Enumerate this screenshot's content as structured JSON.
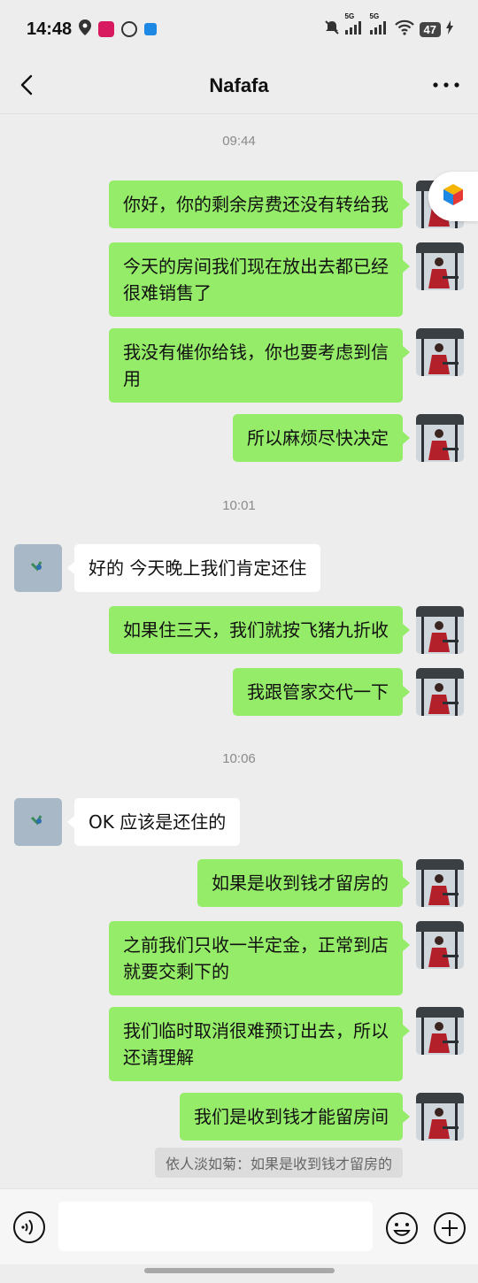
{
  "status_bar": {
    "time": "14:48",
    "battery": "47",
    "network_labels": [
      "5G",
      "5G"
    ],
    "icons": [
      "location-icon",
      "app-icon",
      "app-icon",
      "app-icon",
      "mute-bell-icon",
      "signal-icon",
      "signal-icon",
      "wifi-icon",
      "battery-icon",
      "charging-icon"
    ]
  },
  "header": {
    "title": "Nafafa",
    "back_icon": "chevron-left-icon",
    "more_icon": "more-dots-icon"
  },
  "messages": [
    {
      "type": "time",
      "text": "09:44"
    },
    {
      "type": "out",
      "lines": [
        "你好，你的剩余房费还没有转给我"
      ]
    },
    {
      "type": "out",
      "lines": [
        "今天的房间我们现在放出去都已经",
        "很难销售了"
      ]
    },
    {
      "type": "out",
      "lines": [
        "我没有催你给钱，你也要考虑到信",
        "用"
      ]
    },
    {
      "type": "out",
      "lines": [
        "所以麻烦尽快决定"
      ]
    },
    {
      "type": "time",
      "text": "10:01"
    },
    {
      "type": "in",
      "lines": [
        "好的 今天晚上我们肯定还住"
      ]
    },
    {
      "type": "out",
      "lines": [
        "如果住三天，我们就按飞猪九折收"
      ]
    },
    {
      "type": "out",
      "lines": [
        "我跟管家交代一下"
      ]
    },
    {
      "type": "time",
      "text": "10:06"
    },
    {
      "type": "in",
      "lines": [
        "OK 应该是还住的"
      ]
    },
    {
      "type": "out",
      "lines": [
        "如果是收到钱才留房的"
      ]
    },
    {
      "type": "out",
      "lines": [
        "之前我们只收一半定金，正常到店",
        "就要交剩下的"
      ]
    },
    {
      "type": "out",
      "lines": [
        "我们临时取消很难预订出去，所以",
        "还请理解"
      ]
    },
    {
      "type": "out",
      "lines": [
        "我们是收到钱才能留房间"
      ]
    },
    {
      "type": "quote",
      "text": "依人淡如菊：如果是收到钱才留房的"
    }
  ],
  "input_bar": {
    "voice_icon": "voice-icon",
    "emoji_icon": "emoji-icon",
    "plus_icon": "plus-icon",
    "value": ""
  },
  "colors": {
    "background": "#ededed",
    "outgoing_bubble": "#95ec69",
    "incoming_bubble": "#ffffff",
    "timestamp": "#8a8a8a"
  }
}
